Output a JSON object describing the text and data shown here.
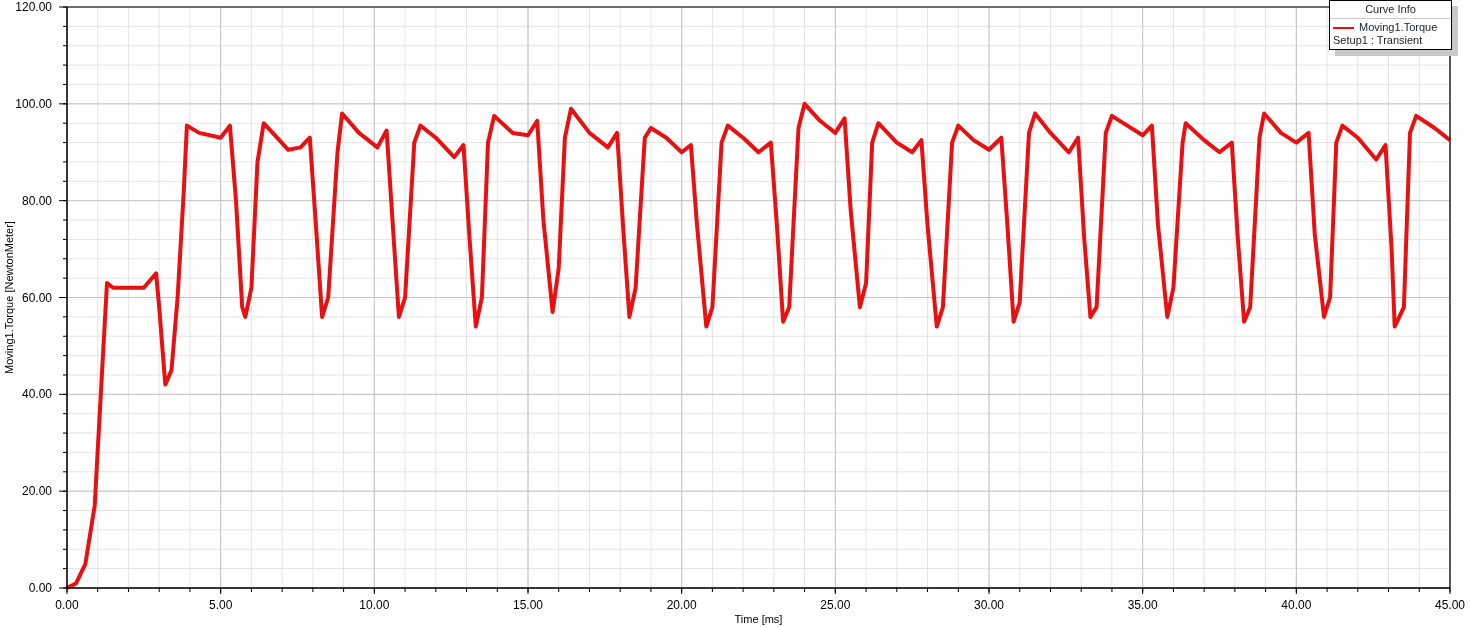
{
  "chart": {
    "chart_data": {
      "type": "line",
      "xlabel": "Time [ms]",
      "ylabel": "Moving1.Torque [NewtonMeter]",
      "x": [
        0,
        0.3,
        0.6,
        0.9,
        1.1,
        1.3,
        1.5,
        2.0,
        2.5,
        2.9,
        3.0,
        3.2,
        3.4,
        3.6,
        3.8,
        3.9,
        4.3,
        5.0,
        5.3,
        5.5,
        5.7,
        5.8,
        6.0,
        6.2,
        6.4,
        7.2,
        7.6,
        7.9,
        8.1,
        8.3,
        8.5,
        8.8,
        8.95,
        9.5,
        10.1,
        10.4,
        10.6,
        10.8,
        11.0,
        11.3,
        11.5,
        12.0,
        12.6,
        12.9,
        13.1,
        13.3,
        13.5,
        13.7,
        13.9,
        14.5,
        15.0,
        15.3,
        15.5,
        15.8,
        16.0,
        16.2,
        16.4,
        17.0,
        17.6,
        17.9,
        18.1,
        18.3,
        18.5,
        18.8,
        19.0,
        19.5,
        20.0,
        20.3,
        20.5,
        20.8,
        21.0,
        21.3,
        21.5,
        22.0,
        22.5,
        22.9,
        23.1,
        23.3,
        23.5,
        23.8,
        24.0,
        24.5,
        25.0,
        25.3,
        25.5,
        25.8,
        26.0,
        26.2,
        26.4,
        27.0,
        27.5,
        27.8,
        28.0,
        28.3,
        28.5,
        28.8,
        29.0,
        29.5,
        30.0,
        30.4,
        30.6,
        30.8,
        31.0,
        31.3,
        31.5,
        32.0,
        32.6,
        32.9,
        33.1,
        33.3,
        33.5,
        33.8,
        34.0,
        34.5,
        35.0,
        35.3,
        35.5,
        35.8,
        36.0,
        36.3,
        36.4,
        37.0,
        37.5,
        37.9,
        38.1,
        38.3,
        38.5,
        38.8,
        38.95,
        39.5,
        40.0,
        40.4,
        40.6,
        40.9,
        41.1,
        41.3,
        41.5,
        42.0,
        42.6,
        42.9,
        43.1,
        43.2,
        43.5,
        43.7,
        43.9,
        44.5,
        45
      ],
      "series": [
        {
          "name": "Moving1.Torque",
          "color": "#e81010",
          "values": [
            0,
            1,
            5,
            17,
            40,
            63,
            62,
            62,
            62,
            65,
            58,
            42,
            45,
            60,
            82,
            95.5,
            94,
            93,
            95.5,
            80,
            58,
            56,
            62,
            88,
            96,
            90.5,
            91,
            93,
            75,
            56,
            60,
            90,
            98,
            94,
            91,
            94.5,
            75,
            56,
            60,
            92,
            95.5,
            93,
            89,
            91.5,
            72,
            54,
            60,
            92,
            97.5,
            94,
            93.5,
            96.5,
            76,
            57,
            66,
            93,
            99,
            94,
            91,
            94,
            74,
            56,
            62,
            93,
            95,
            93,
            90,
            91.5,
            75,
            54,
            58,
            92,
            95.5,
            93,
            90,
            92,
            75,
            55,
            58,
            95,
            100,
            96.5,
            94,
            97,
            78,
            58,
            63,
            92,
            96,
            92,
            90,
            92.5,
            75,
            54,
            58,
            92,
            95.5,
            92.5,
            90.5,
            93,
            75,
            55,
            59,
            94,
            98,
            94,
            90,
            93,
            72,
            56,
            58,
            94,
            97.5,
            95.5,
            93.5,
            95.5,
            75,
            56,
            62,
            92,
            96,
            92.5,
            90,
            92,
            72,
            55,
            58,
            93,
            98,
            94,
            92,
            94,
            73,
            56,
            60,
            92,
            95.5,
            93,
            88.5,
            91.5,
            70,
            54,
            58,
            94,
            97.5,
            95,
            92.5
          ]
        }
      ],
      "xlim": [
        0,
        45
      ],
      "ylim": [
        0,
        120
      ],
      "grid": true,
      "xticks": [
        {
          "value": 0,
          "label": "0.00"
        },
        {
          "value": 5,
          "label": "5.00"
        },
        {
          "value": 10,
          "label": "10.00"
        },
        {
          "value": 15,
          "label": "15.00"
        },
        {
          "value": 20,
          "label": "20.00"
        },
        {
          "value": 25,
          "label": "25.00"
        },
        {
          "value": 30,
          "label": "30.00"
        },
        {
          "value": 35,
          "label": "35.00"
        },
        {
          "value": 40,
          "label": "40.00"
        },
        {
          "value": 45,
          "label": "45.00"
        }
      ],
      "yticks": [
        {
          "value": 0,
          "label": "0.00"
        },
        {
          "value": 20,
          "label": "20.00"
        },
        {
          "value": 40,
          "label": "40.00"
        },
        {
          "value": 60,
          "label": "60.00"
        },
        {
          "value": 80,
          "label": "80.00"
        },
        {
          "value": 100,
          "label": "100.00"
        },
        {
          "value": 120,
          "label": "120.00"
        }
      ]
    }
  },
  "legend": {
    "title": "Curve Info",
    "entries": [
      {
        "setup": "Setup1 : Transient"
      }
    ]
  }
}
